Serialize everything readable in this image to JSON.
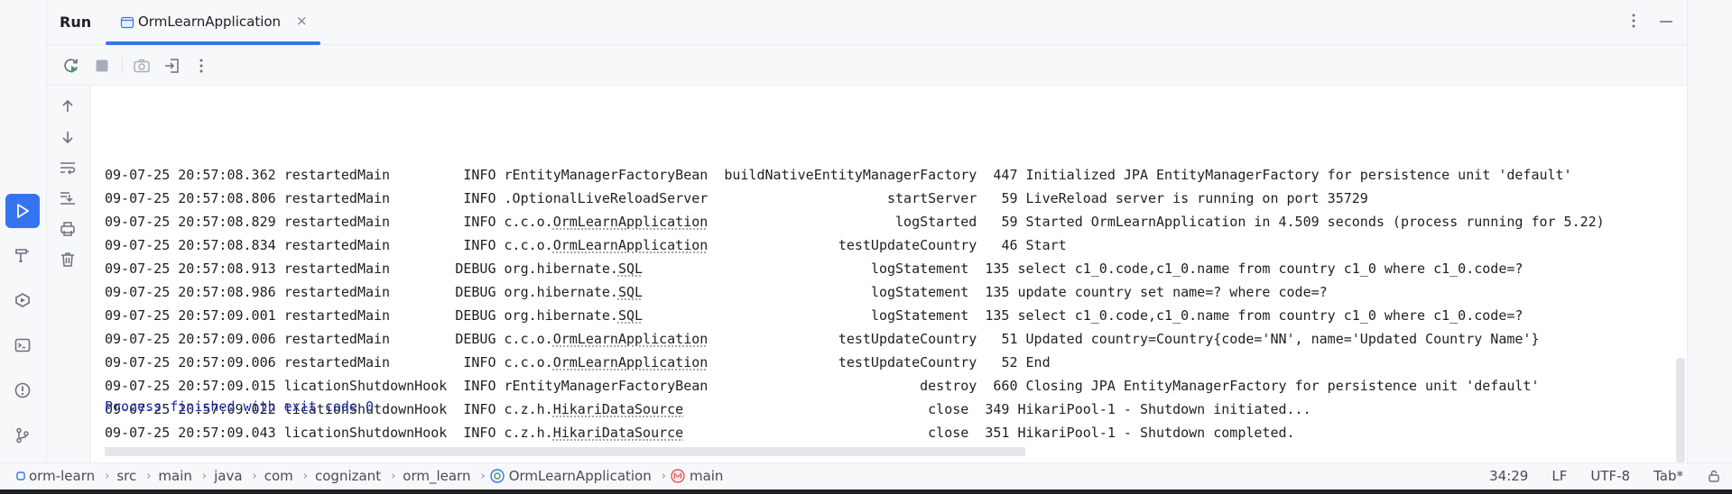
{
  "panel": {
    "title": "Run",
    "tab_label": "OrmLearnApplication",
    "tab_close": "×"
  },
  "log_rows": [
    {
      "date": "09-07-25 20:57:08.362",
      "thread": "restartedMain",
      "level": "INFO",
      "logger_pre": "rEntityManagerFactoryBean",
      "logger_u": "",
      "method": "buildNativeEntityManagerFactory",
      "line": "447",
      "msg": "Initialized JPA EntityManagerFactory for persistence unit 'default'"
    },
    {
      "date": "09-07-25 20:57:08.806",
      "thread": "restartedMain",
      "level": "INFO",
      "logger_pre": ".OptionalLiveReloadServer",
      "logger_u": "",
      "method": "startServer",
      "line": "59",
      "msg": "LiveReload server is running on port 35729"
    },
    {
      "date": "09-07-25 20:57:08.829",
      "thread": "restartedMain",
      "level": "INFO",
      "logger_pre": "c.c.o.",
      "logger_u": "OrmLearnApplication",
      "method": "logStarted",
      "line": "59",
      "msg": "Started OrmLearnApplication in 4.509 seconds (process running for 5.22)"
    },
    {
      "date": "09-07-25 20:57:08.834",
      "thread": "restartedMain",
      "level": "INFO",
      "logger_pre": "c.c.o.",
      "logger_u": "OrmLearnApplication",
      "method": "testUpdateCountry",
      "line": "46",
      "msg": "Start"
    },
    {
      "date": "09-07-25 20:57:08.913",
      "thread": "restartedMain",
      "level": "DEBUG",
      "logger_pre": "org.hibernate.",
      "logger_u": "SQL",
      "method": "logStatement",
      "line": "135",
      "msg": "select c1_0.code,c1_0.name from country c1_0 where c1_0.code=?"
    },
    {
      "date": "09-07-25 20:57:08.986",
      "thread": "restartedMain",
      "level": "DEBUG",
      "logger_pre": "org.hibernate.",
      "logger_u": "SQL",
      "method": "logStatement",
      "line": "135",
      "msg": "update country set name=? where code=?"
    },
    {
      "date": "09-07-25 20:57:09.001",
      "thread": "restartedMain",
      "level": "DEBUG",
      "logger_pre": "org.hibernate.",
      "logger_u": "SQL",
      "method": "logStatement",
      "line": "135",
      "msg": "select c1_0.code,c1_0.name from country c1_0 where c1_0.code=?"
    },
    {
      "date": "09-07-25 20:57:09.006",
      "thread": "restartedMain",
      "level": "DEBUG",
      "logger_pre": "c.c.o.",
      "logger_u": "OrmLearnApplication",
      "method": "testUpdateCountry",
      "line": "51",
      "msg": "Updated country=Country{code='NN', name='Updated Country Name'}"
    },
    {
      "date": "09-07-25 20:57:09.006",
      "thread": "restartedMain",
      "level": "INFO",
      "logger_pre": "c.c.o.",
      "logger_u": "OrmLearnApplication",
      "method": "testUpdateCountry",
      "line": "52",
      "msg": "End"
    },
    {
      "date": "09-07-25 20:57:09.015",
      "thread": "licationShutdownHook",
      "level": "INFO",
      "logger_pre": "rEntityManagerFactoryBean",
      "logger_u": "",
      "method": "destroy",
      "line": "660",
      "msg": "Closing JPA EntityManagerFactory for persistence unit 'default'"
    },
    {
      "date": "09-07-25 20:57:09.022",
      "thread": "licationShutdownHook",
      "level": "INFO",
      "logger_pre": "c.z.h.",
      "logger_u": "HikariDataSource",
      "method": "close",
      "line": "349",
      "msg": "HikariPool-1 - Shutdown initiated..."
    },
    {
      "date": "09-07-25 20:57:09.043",
      "thread": "licationShutdownHook",
      "level": "INFO",
      "logger_pre": "c.z.h.",
      "logger_u": "HikariDataSource",
      "method": "close",
      "line": "351",
      "msg": "HikariPool-1 - Shutdown completed."
    }
  ],
  "exit_message": "Process finished with exit code 0",
  "breadcrumbs": [
    "orm-learn",
    "src",
    "main",
    "java",
    "com",
    "cognizant",
    "orm_learn",
    "OrmLearnApplication",
    "main"
  ],
  "breadcrumb_separator": "›",
  "status": {
    "position": "34:29",
    "line_ending": "LF",
    "encoding": "UTF-8",
    "indent": "Tab*"
  },
  "icons": {
    "strip": [
      "run-icon",
      "build-icon",
      "services-icon",
      "terminal-icon",
      "problems-icon",
      "git-icon"
    ],
    "toolbar": [
      "rerun-icon",
      "stop-icon",
      "camera-icon",
      "exit-icon",
      "more-icon"
    ],
    "console_tools": [
      "arrow-up-icon",
      "arrow-down-icon",
      "soft-wrap-icon",
      "scroll-to-end-icon",
      "print-icon",
      "trash-icon"
    ]
  },
  "colors": {
    "accent": "#3574f0",
    "exit_text": "#1a27a6",
    "run_green": "#499c54"
  }
}
